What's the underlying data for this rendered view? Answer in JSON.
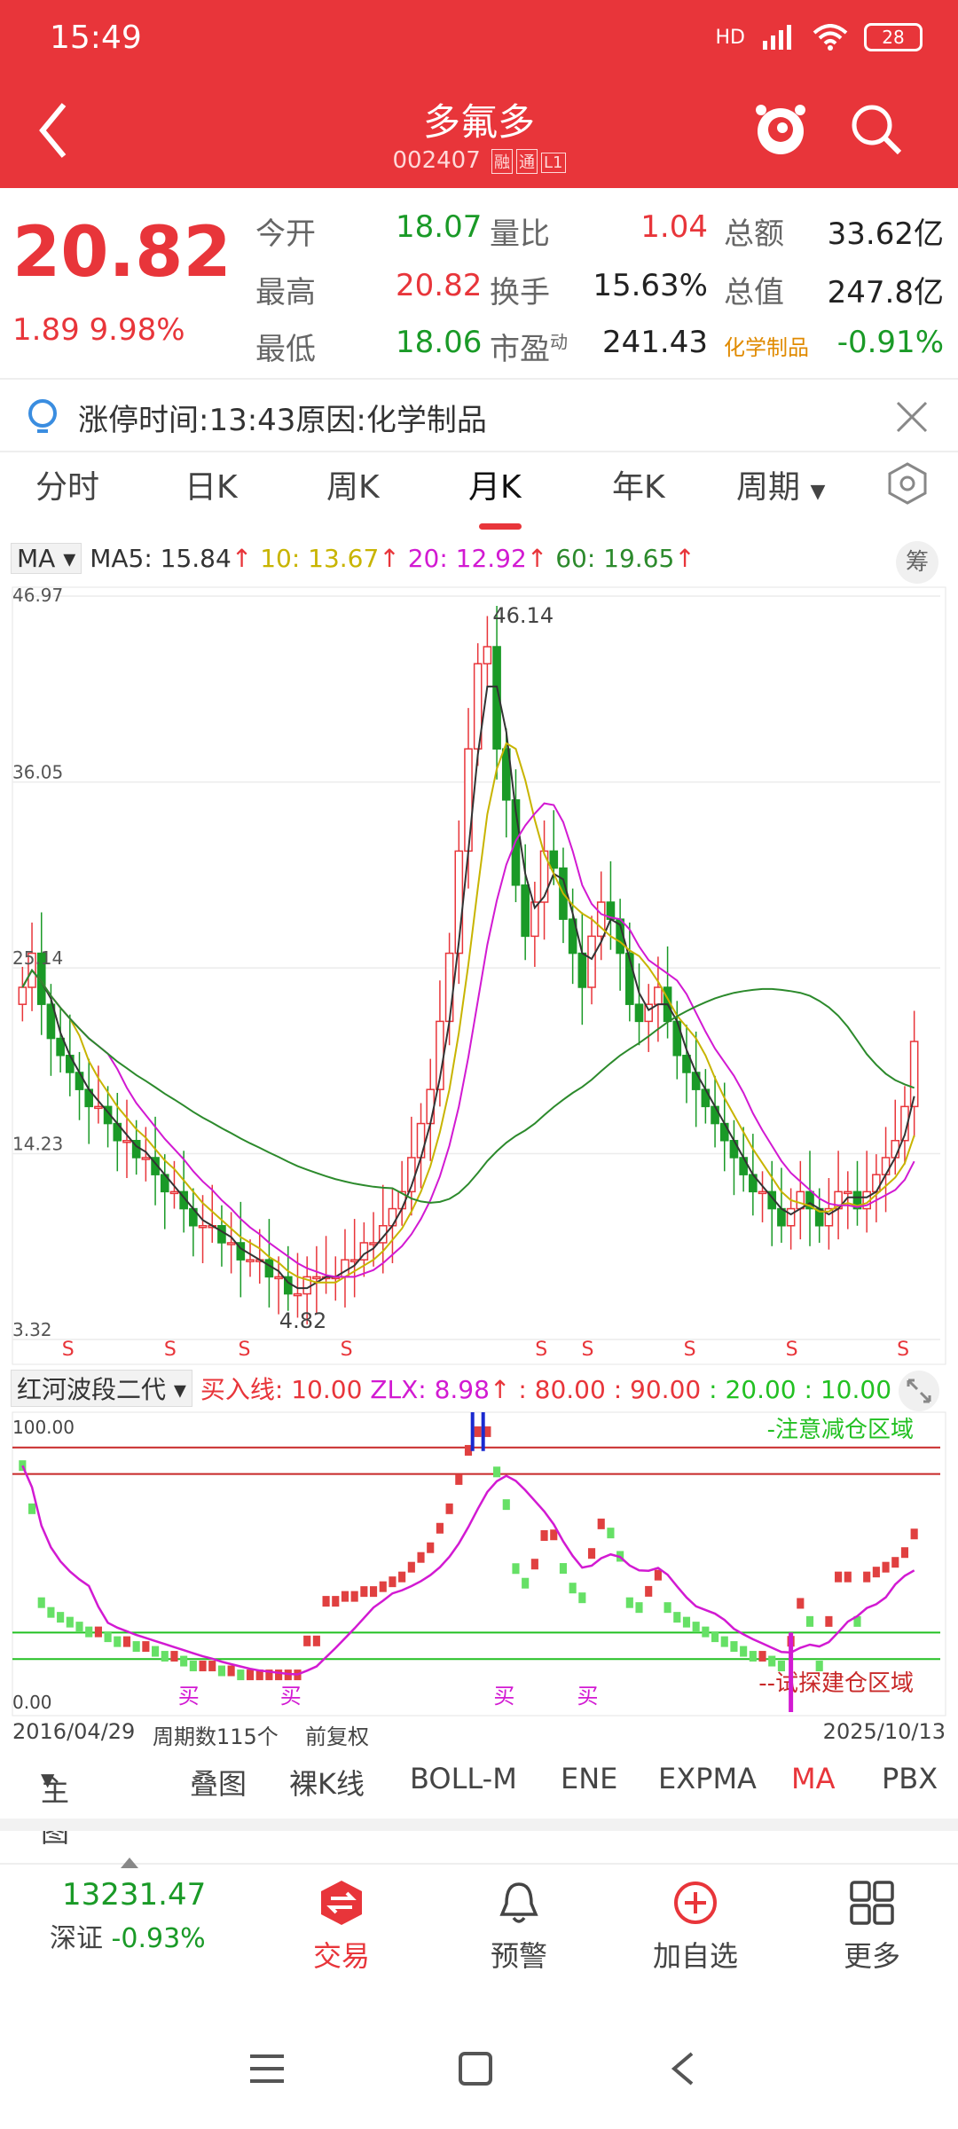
{
  "status": {
    "time": "15:49",
    "hd": "HD",
    "battery": "28"
  },
  "header": {
    "title": "多氟多",
    "code": "002407",
    "tags": [
      "融",
      "通",
      "L1"
    ]
  },
  "quote": {
    "price": "20.82",
    "change": "1.89",
    "change_pct": "9.98%",
    "rows": [
      {
        "l1": "今开",
        "v1": "18.07",
        "l2": "量比",
        "v2": "1.04",
        "l3": "总额",
        "v3": "33.62亿"
      },
      {
        "l1": "最高",
        "v1": "20.82",
        "l2": "换手",
        "v2": "15.63%",
        "l3": "总值",
        "v3": "247.8亿"
      },
      {
        "l1": "最低",
        "v1": "18.06",
        "l2": "市盈",
        "l2sup": "动",
        "v2": "241.43",
        "l3": "化学制品",
        "v3": "-0.91%"
      }
    ]
  },
  "notice": {
    "text": "涨停时间:13:43原因:化学制品"
  },
  "tabs": [
    "分时",
    "日K",
    "周K",
    "月K",
    "年K",
    "周期"
  ],
  "active_tab": "月K",
  "ma_bar": {
    "selector": "MA",
    "ma5": "MA5: 15.84",
    "ma10": "10: 13.67",
    "ma20": "20: 12.92",
    "ma60": "60: 19.65",
    "chip_btn": "筹"
  },
  "main_axis": {
    "labels": [
      "46.97",
      "36.05",
      "25.14",
      "14.23",
      "3.32"
    ],
    "high_label": "46.14",
    "low_label": "4.82",
    "s_mark": "S"
  },
  "indicator_bar": {
    "name": "红河波段二代",
    "buy_line": "买入线: 10.00",
    "zlx": "ZLX: 8.98",
    "l80": ": 80.00",
    "l90": ": 90.00",
    "l20": ": 20.00",
    "l10": ": 10.00"
  },
  "indicator_axis": {
    "top": "100.00",
    "bottom": "0.00",
    "warn_text": "-注意减仓区域",
    "build_text": "--试探建仓区域",
    "buy_mark": "买"
  },
  "date_row": {
    "start": "2016/04/29",
    "count": "周期数115个",
    "adj": "前复权",
    "end": "2025/10/13"
  },
  "sub_tools": [
    "主图",
    "叠图",
    "裸K线",
    "BOLL-M",
    "ENE",
    "EXPMA",
    "MA",
    "PBX"
  ],
  "active_sub_tool": "MA",
  "bottom_nav": {
    "index_value": "13231.47",
    "index_name": "深证",
    "index_change": "-0.93%",
    "trade": "交易",
    "alert": "预警",
    "add": "加自选",
    "more": "更多"
  },
  "colors": {
    "up": "#e8353a",
    "down": "#1a9a27",
    "ma5": "#333333",
    "ma10": "#c8b400",
    "ma20": "#d21ad2",
    "ma60": "#2c8a2c"
  },
  "chart_data": [
    {
      "type": "candlestick",
      "title": "",
      "period": "monthly",
      "ylim": [
        3.32,
        46.97
      ],
      "series": [
        {
          "name": "MA5",
          "value": 15.84
        },
        {
          "name": "10",
          "value": 13.67
        },
        {
          "name": "20",
          "value": 12.92
        },
        {
          "name": "60",
          "value": 19.65
        }
      ],
      "highest": 46.14,
      "lowest": 4.82,
      "x_range": [
        "2016/04/29",
        "2025/10/13"
      ],
      "close_path": [
        24,
        26,
        23,
        21,
        20,
        19,
        18,
        17,
        17,
        16,
        15,
        15,
        14,
        14,
        13,
        12,
        12,
        11,
        10,
        10,
        10,
        9,
        9,
        8,
        8,
        8,
        7,
        7,
        6,
        6,
        7,
        7,
        7,
        7,
        8,
        8,
        9,
        9,
        10,
        11,
        12,
        14,
        16,
        18,
        22,
        26,
        32,
        38,
        43,
        44,
        38,
        35,
        30,
        27,
        29,
        32,
        31,
        28,
        26,
        24,
        27,
        29,
        28,
        26,
        23,
        22,
        23,
        24,
        22,
        20,
        19,
        18,
        17,
        16,
        15,
        14,
        13,
        12,
        12,
        11,
        10,
        11,
        12,
        11,
        10,
        11,
        12,
        12,
        11,
        12,
        13,
        14,
        15,
        17,
        20.82
      ]
    },
    {
      "type": "line",
      "title": "",
      "ylim": [
        0,
        100
      ],
      "levels": [
        10,
        20,
        80,
        90
      ]
    }
  ]
}
